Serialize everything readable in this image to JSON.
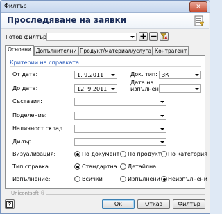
{
  "window": {
    "title": "Филтър",
    "close_glyph": "✕"
  },
  "header": {
    "title": "Проследяване на заявки"
  },
  "filter": {
    "label": "Готов филтър:",
    "value": ""
  },
  "tabs": [
    {
      "label": "Основни"
    },
    {
      "label": "Допълнителни"
    },
    {
      "label": "Продукт/материал/услуга"
    },
    {
      "label": "Контрагент"
    }
  ],
  "criteria": {
    "heading": "Критерии на справката"
  },
  "fields": {
    "from_date": {
      "label": "От дата:",
      "value": "1.  9.2011"
    },
    "to_date": {
      "label": "До дата:",
      "value": "12.  9.2011"
    },
    "doc_type": {
      "label": "Док. тип:",
      "value": "ЗК"
    },
    "exec_date": {
      "label": "Дата на изпълнение:",
      "value": ""
    },
    "composer": {
      "label": "Съставил:",
      "value": ""
    },
    "department": {
      "label": "Поделение:",
      "value": ""
    },
    "warehouse": {
      "label": "Наличност склад",
      "value": ""
    },
    "dealer": {
      "label": "Дилър:",
      "value": ""
    }
  },
  "visualization": {
    "label": "Визуализация:",
    "options": [
      "По документ",
      "По продукт",
      "По категория"
    ],
    "selected": 0
  },
  "report_type": {
    "label": "Тип справка:",
    "options": [
      "Стандартна",
      "Детайлна"
    ],
    "selected": 0
  },
  "execution": {
    "label": "Изпълнение:",
    "options": [
      "Всички",
      "Изпълнени",
      "Неизпълнени"
    ],
    "selected": 2
  },
  "footer": {
    "brand": "Unicontsoft ®"
  },
  "buttons": {
    "ok": "Ок",
    "cancel": "Отказ",
    "filter": "Филтър"
  }
}
